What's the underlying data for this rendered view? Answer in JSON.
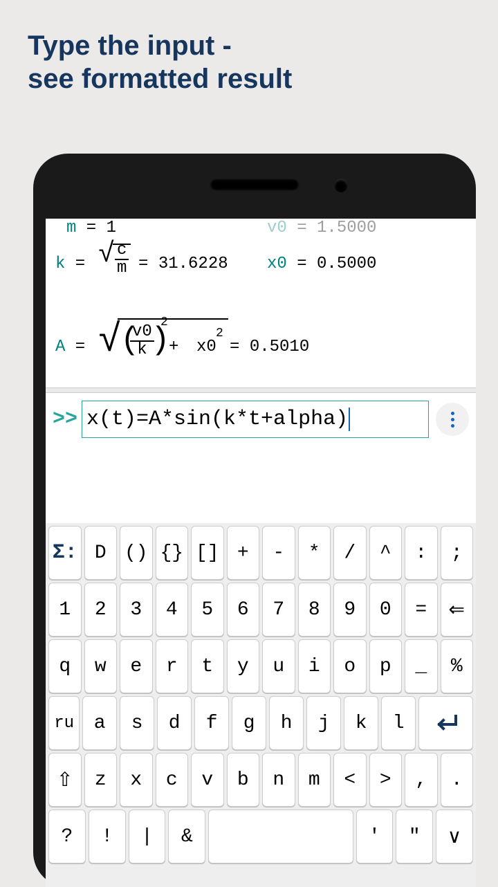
{
  "title_line1": "Type the input -",
  "title_line2": "see formatted result",
  "formula": {
    "m_var": "m",
    "eq": " = ",
    "m_val": "1",
    "v0_var": "v0",
    "v0_val": "1.5000",
    "k_var": "k",
    "c": "c",
    "m2": "m",
    "k_val": "31.6228",
    "x0_var": "x0",
    "x0_val": "0.5000",
    "A_var": "A",
    "v0": "v0",
    "k2": "k",
    "two": "2",
    "plus": " + ",
    "x0": "x0",
    "A_val": "0.5010"
  },
  "input": {
    "prompt": ">>",
    "value": "x(t)=A*sin(k*t+alpha)"
  },
  "keys": {
    "r1": [
      "Σ:",
      "D",
      "()",
      "{}",
      "[]",
      "+",
      "-",
      "*",
      "/",
      "^",
      ":",
      ";"
    ],
    "r2": [
      "1",
      "2",
      "3",
      "4",
      "5",
      "6",
      "7",
      "8",
      "9",
      "0",
      "=",
      "⇐"
    ],
    "r3": [
      "q",
      "w",
      "e",
      "r",
      "t",
      "y",
      "u",
      "i",
      "o",
      "p",
      "_",
      "%"
    ],
    "r4_lang": "ru",
    "r4": [
      "a",
      "s",
      "d",
      "f",
      "g",
      "h",
      "j",
      "k",
      "l"
    ],
    "r5_shift": "⇧",
    "r5": [
      "z",
      "x",
      "c",
      "v",
      "b",
      "n",
      "m",
      "<",
      ">",
      ",",
      "."
    ],
    "r6": [
      "?",
      "!",
      "|",
      "&"
    ],
    "r6b": [
      "'",
      "\"",
      "∨"
    ]
  }
}
